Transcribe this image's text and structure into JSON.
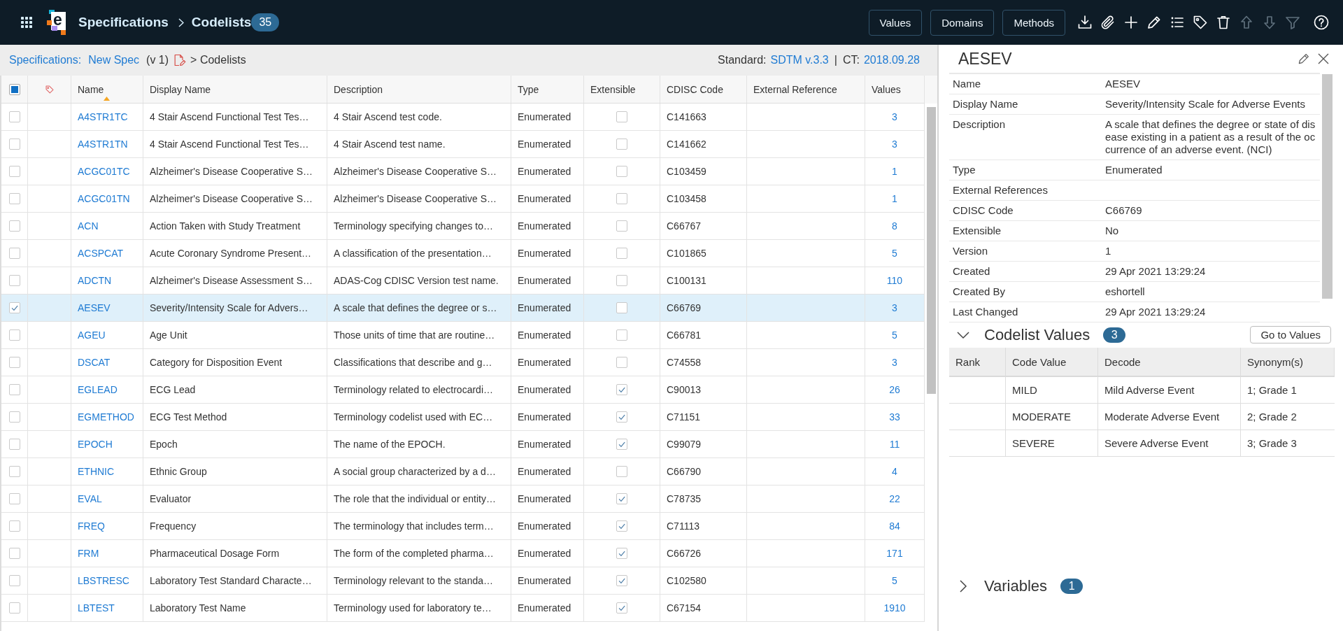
{
  "header": {
    "logo_letter": "e",
    "title": "Specifications",
    "section": "Codelists",
    "count": "35",
    "buttons": [
      "Values",
      "Domains",
      "Methods"
    ],
    "toolbar": [
      {
        "disabled": false
      },
      {
        "disabled": false
      },
      {
        "disabled": false
      },
      {
        "disabled": false
      },
      {
        "disabled": false
      },
      {
        "disabled": false
      },
      {
        "disabled": false
      },
      {
        "disabled": true
      },
      {
        "disabled": true
      },
      {
        "disabled": true
      },
      {
        "disabled": false
      }
    ]
  },
  "breadcrumb": {
    "root": "Specifications:",
    "spec": "New Spec",
    "version": "(v 1)",
    "current": "> Codelists",
    "standard_label": "Standard:",
    "standard": "SDTM v.3.3",
    "separator": "|",
    "ct_label": "CT:",
    "ct": "2018.09.28"
  },
  "table": {
    "select_all": {
      "checked": false,
      "indeterminate": true
    },
    "columns": [
      {
        "label": "Name",
        "sorted": true
      },
      {
        "label": "Display Name",
        "sorted": false
      },
      {
        "label": "Description",
        "sorted": false
      },
      {
        "label": "Type",
        "sorted": false
      },
      {
        "label": "Extensible",
        "sorted": false
      },
      {
        "label": "CDISC Code",
        "sorted": false
      },
      {
        "label": "External Reference",
        "sorted": false
      },
      {
        "label": "Values",
        "sorted": false
      }
    ],
    "rows": [
      {
        "selected": false,
        "name": "A4STR1TC",
        "display_name": "4 Stair Ascend Functional Test Tes…",
        "description": "4 Stair Ascend test code.",
        "type": "Enumerated",
        "extensible": false,
        "cdisc_code": "C141663",
        "values": "3"
      },
      {
        "selected": false,
        "name": "A4STR1TN",
        "display_name": "4 Stair Ascend Functional Test Tes…",
        "description": "4 Stair Ascend test name.",
        "type": "Enumerated",
        "extensible": false,
        "cdisc_code": "C141662",
        "values": "3"
      },
      {
        "selected": false,
        "name": "ACGC01TC",
        "display_name": "Alzheimer's Disease Cooperative S…",
        "description": "Alzheimer's Disease Cooperative S…",
        "type": "Enumerated",
        "extensible": false,
        "cdisc_code": "C103459",
        "values": "1"
      },
      {
        "selected": false,
        "name": "ACGC01TN",
        "display_name": "Alzheimer's Disease Cooperative S…",
        "description": "Alzheimer's Disease Cooperative S…",
        "type": "Enumerated",
        "extensible": false,
        "cdisc_code": "C103458",
        "values": "1"
      },
      {
        "selected": false,
        "name": "ACN",
        "display_name": "Action Taken with Study Treatment",
        "description": "Terminology specifying changes to…",
        "type": "Enumerated",
        "extensible": false,
        "cdisc_code": "C66767",
        "values": "8"
      },
      {
        "selected": false,
        "name": "ACSPCAT",
        "display_name": "Acute Coronary Syndrome Present…",
        "description": "A classification of the presentation…",
        "type": "Enumerated",
        "extensible": false,
        "cdisc_code": "C101865",
        "values": "5"
      },
      {
        "selected": false,
        "name": "ADCTN",
        "display_name": "Alzheimer's Disease Assessment S…",
        "description": "ADAS-Cog CDISC Version test name.",
        "type": "Enumerated",
        "extensible": false,
        "cdisc_code": "C100131",
        "values": "110"
      },
      {
        "selected": true,
        "name": "AESEV",
        "display_name": "Severity/Intensity Scale for Advers…",
        "description": "A scale that defines the degree or s…",
        "type": "Enumerated",
        "extensible": false,
        "cdisc_code": "C66769",
        "values": "3"
      },
      {
        "selected": false,
        "name": "AGEU",
        "display_name": "Age Unit",
        "description": "Those units of time that are routine…",
        "type": "Enumerated",
        "extensible": false,
        "cdisc_code": "C66781",
        "values": "5"
      },
      {
        "selected": false,
        "name": "DSCAT",
        "display_name": "Category for Disposition Event",
        "description": "Classifications that describe and g…",
        "type": "Enumerated",
        "extensible": false,
        "cdisc_code": "C74558",
        "values": "3"
      },
      {
        "selected": false,
        "name": "EGLEAD",
        "display_name": "ECG Lead",
        "description": "Terminology related to electrocardi…",
        "type": "Enumerated",
        "extensible": true,
        "cdisc_code": "C90013",
        "values": "26"
      },
      {
        "selected": false,
        "name": "EGMETHOD",
        "display_name": "ECG Test Method",
        "description": "Terminology codelist used with EC…",
        "type": "Enumerated",
        "extensible": true,
        "cdisc_code": "C71151",
        "values": "33"
      },
      {
        "selected": false,
        "name": "EPOCH",
        "display_name": "Epoch",
        "description": "The name of the EPOCH.",
        "type": "Enumerated",
        "extensible": true,
        "cdisc_code": "C99079",
        "values": "11"
      },
      {
        "selected": false,
        "name": "ETHNIC",
        "display_name": "Ethnic Group",
        "description": "A social group characterized by a d…",
        "type": "Enumerated",
        "extensible": false,
        "cdisc_code": "C66790",
        "values": "4"
      },
      {
        "selected": false,
        "name": "EVAL",
        "display_name": "Evaluator",
        "description": "The role that the individual or entity…",
        "type": "Enumerated",
        "extensible": true,
        "cdisc_code": "C78735",
        "values": "22"
      },
      {
        "selected": false,
        "name": "FREQ",
        "display_name": "Frequency",
        "description": "The terminology that includes term…",
        "type": "Enumerated",
        "extensible": true,
        "cdisc_code": "C71113",
        "values": "84"
      },
      {
        "selected": false,
        "name": "FRM",
        "display_name": "Pharmaceutical Dosage Form",
        "description": "The form of the completed pharma…",
        "type": "Enumerated",
        "extensible": true,
        "cdisc_code": "C66726",
        "values": "171"
      },
      {
        "selected": false,
        "name": "LBSTRESC",
        "display_name": "Laboratory Test Standard Characte…",
        "description": "Terminology relevant to the standa…",
        "type": "Enumerated",
        "extensible": true,
        "cdisc_code": "C102580",
        "values": "5"
      },
      {
        "selected": false,
        "name": "LBTEST",
        "display_name": "Laboratory Test Name",
        "description": "Terminology used for laboratory te…",
        "type": "Enumerated",
        "extensible": true,
        "cdisc_code": "C67154",
        "values": "1910"
      }
    ]
  },
  "detail": {
    "title": "AESEV",
    "properties": [
      {
        "label": "Name",
        "value": "AESEV"
      },
      {
        "label": "Display Name",
        "value": "Severity/Intensity Scale for Adverse Events"
      },
      {
        "label": "Description",
        "value": "A scale that defines the degree or state of disease existing in a patient as a result of the occurrence of an adverse event. (NCI)"
      },
      {
        "label": "Type",
        "value": "Enumerated"
      },
      {
        "label": "External References"
      },
      {
        "label": "CDISC Code",
        "value": "C66769"
      },
      {
        "label": "Extensible",
        "value": "No"
      },
      {
        "label": "Version",
        "value": "1"
      },
      {
        "label": "Created",
        "value": "29 Apr 2021 13:29:24"
      },
      {
        "label": "Created By",
        "value": "eshortell"
      },
      {
        "label": "Last Changed",
        "value": "29 Apr 2021 13:29:24"
      }
    ],
    "codelist_values": {
      "title": "Codelist Values",
      "count": "3",
      "expanded": true,
      "button": "Go to Values",
      "columns": [
        "Rank",
        "Code Value",
        "Decode",
        "Synonym(s)"
      ],
      "rows": [
        {
          "code_value": "MILD",
          "decode": "Mild Adverse Event",
          "synonyms": "1; Grade 1"
        },
        {
          "code_value": "MODERATE",
          "decode": "Moderate Adverse Event",
          "synonyms": "2; Grade 2"
        },
        {
          "code_value": "SEVERE",
          "decode": "Severe Adverse Event",
          "synonyms": "3; Grade 3"
        }
      ]
    },
    "variables": {
      "title": "Variables",
      "count": "1",
      "expanded": false
    }
  }
}
